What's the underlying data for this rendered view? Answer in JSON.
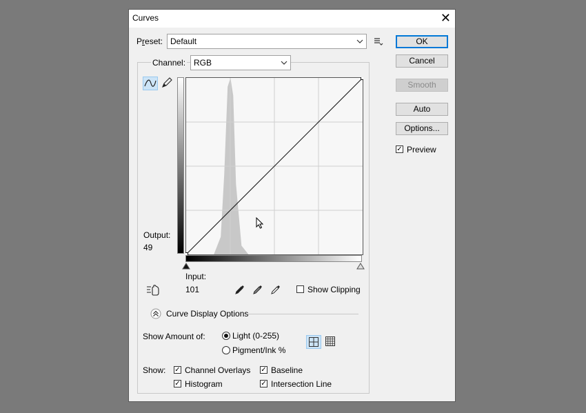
{
  "window": {
    "title": "Curves",
    "close_symbol": "✕"
  },
  "preset": {
    "label": "Preset:",
    "label_mnemonic": "r",
    "value": "Default"
  },
  "channel": {
    "label": "Channel:",
    "value": "RGB"
  },
  "buttons": {
    "ok": "OK",
    "cancel": "Cancel",
    "smooth": "Smooth",
    "auto": "Auto",
    "options": "Options..."
  },
  "preview": {
    "label": "Preview",
    "checked": true
  },
  "output": {
    "label": "Output:",
    "value": "49"
  },
  "input": {
    "label": "Input:",
    "value": "101"
  },
  "show_clipping": {
    "label": "Show Clipping",
    "checked": false
  },
  "curve_display_options": {
    "label": "Curve Display Options"
  },
  "show_amount": {
    "label": "Show Amount of:",
    "options": [
      {
        "label": "Light  (0-255)",
        "selected": true
      },
      {
        "label": "Pigment/Ink %",
        "selected": false
      }
    ]
  },
  "show": {
    "label": "Show:",
    "options": [
      {
        "label": "Channel Overlays",
        "checked": true
      },
      {
        "label": "Baseline",
        "checked": true
      },
      {
        "label": "Histogram",
        "checked": true
      },
      {
        "label": "Intersection Line",
        "checked": true
      }
    ]
  },
  "icons": {
    "preset_menu": "preset-options-icon",
    "curve_tool": "curve-point-tool-icon",
    "pencil_tool": "pencil-tool-icon",
    "hand_tool": "on-image-adjust-icon",
    "black_eyedropper": "black-point-eyedropper-icon",
    "gray_eyedropper": "gray-point-eyedropper-icon",
    "white_eyedropper": "white-point-eyedropper-icon",
    "collapse": "collapse-chevron-icon",
    "simple_grid": "simple-grid-icon",
    "detailed_grid": "detailed-grid-icon"
  },
  "chart_data": {
    "type": "area",
    "xlim": [
      0,
      255
    ],
    "ylim": [
      0,
      255
    ],
    "grid": "4x4",
    "histogram": {
      "x": [
        0,
        40,
        50,
        55,
        60,
        64,
        68,
        72,
        80,
        90,
        255
      ],
      "y": [
        0,
        0,
        0.1,
        0.45,
        0.95,
        1.0,
        0.9,
        0.4,
        0.05,
        0,
        0
      ]
    },
    "curve": {
      "x": [
        0,
        255
      ],
      "y": [
        0,
        255
      ]
    }
  }
}
